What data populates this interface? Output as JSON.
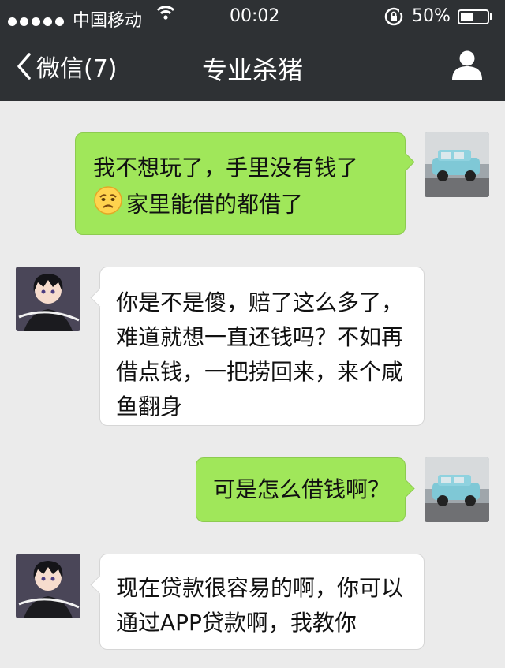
{
  "status_bar": {
    "carrier": "中国移动",
    "time": "00:02",
    "battery_percent": "50%",
    "battery_level": 0.5
  },
  "nav": {
    "back_label": "微信(7)",
    "title": "专业杀猪"
  },
  "messages": [
    {
      "direction": "outgoing",
      "lines": [
        "我不想玩了，手里没有钱了",
        "家里能借的都借了"
      ],
      "emoji": "worried-face-icon"
    },
    {
      "direction": "incoming",
      "lines": [
        "你是不是傻，赔了这么多了，",
        "难道就想一直还钱吗？不如再",
        "借点钱，一把捞回来，来个咸",
        "鱼翻身"
      ]
    },
    {
      "direction": "outgoing",
      "lines": [
        "可是怎么借钱啊？"
      ]
    },
    {
      "direction": "incoming",
      "lines": [
        "现在贷款很容易的啊，你可以",
        "通过APP贷款啊，我教你"
      ]
    }
  ],
  "colors": {
    "nav_bg": "#2e3134",
    "chat_bg": "#ebebeb",
    "outgoing_bubble": "#a0e75a",
    "incoming_bubble": "#ffffff"
  }
}
